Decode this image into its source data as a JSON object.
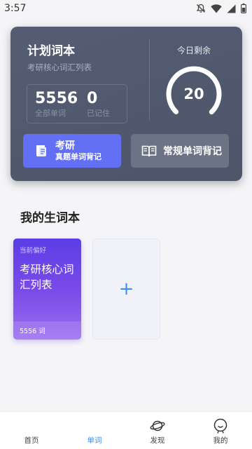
{
  "status_bar": {
    "time": "3:57",
    "icons": [
      "notifications-off-icon",
      "wifi-icon",
      "signal-icon",
      "battery-icon"
    ]
  },
  "plan_card": {
    "title": "计划词本",
    "subtitle": "考研核心词汇列表",
    "stats": [
      {
        "value": "5556",
        "label": "全部单词"
      },
      {
        "value": "0",
        "label": "已记住"
      }
    ],
    "today_label": "今日剩余",
    "today_remaining": "20",
    "buttons": {
      "kaoyan_line1": "考研",
      "kaoyan_line2": "真题单词背记",
      "normal": "常规单词背记"
    }
  },
  "vocab_section": {
    "title": "我的生词本",
    "current_book": {
      "tag": "当前偏好",
      "name": "考研核心词汇列表",
      "count": "5556 词"
    },
    "add_symbol": "+"
  },
  "bottom_nav": {
    "active": 1,
    "items": [
      {
        "label": "首页",
        "icon": "home-icon"
      },
      {
        "label": "单词",
        "icon": "words-icon"
      },
      {
        "label": "发现",
        "icon": "planet-icon"
      },
      {
        "label": "我的",
        "icon": "profile-icon"
      }
    ]
  },
  "colors": {
    "card_bg": "#515970",
    "accent_blue": "#6370f5",
    "vocab_purple": "#6a44e8",
    "active_tab": "#3d8ff0"
  }
}
